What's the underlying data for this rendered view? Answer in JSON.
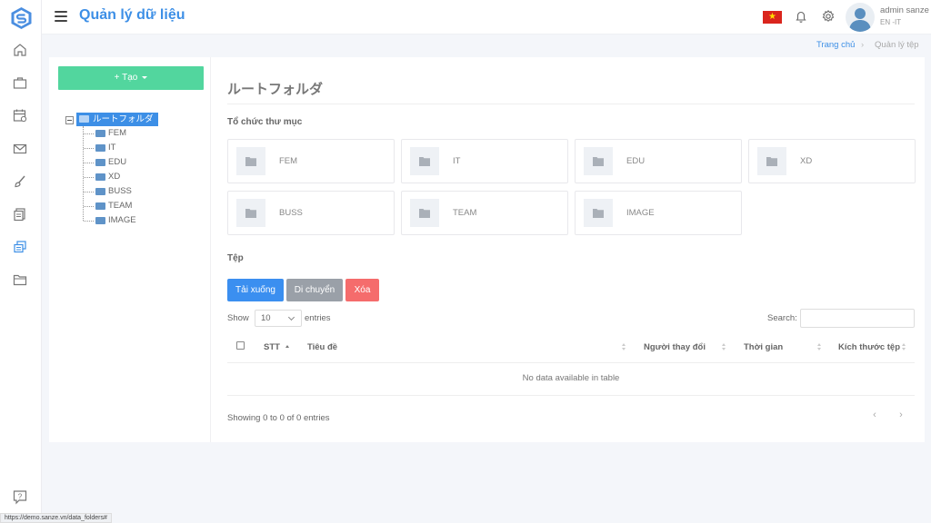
{
  "header": {
    "title": "Quản lý dữ liệu",
    "user_name": "admin sanze",
    "user_sub": "EN -IT",
    "flag_star": "★"
  },
  "sidebar": {
    "items": [
      {
        "name": "home-icon"
      },
      {
        "name": "briefcase-icon"
      },
      {
        "name": "calendar-icon"
      },
      {
        "name": "mail-icon"
      },
      {
        "name": "brush-icon"
      },
      {
        "name": "documents-icon"
      },
      {
        "name": "database-icon",
        "active": true
      },
      {
        "name": "folder-icon"
      }
    ],
    "help_icon": "help-icon"
  },
  "breadcrumb": {
    "home": "Trang chủ",
    "separator": "›",
    "current": "Quản lý tệp"
  },
  "create_button": "+ Tạo",
  "tree": {
    "root": "ルートフォルダ",
    "children": [
      "FEM",
      "IT",
      "EDU",
      "XD",
      "BUSS",
      "TEAM",
      "IMAGE"
    ]
  },
  "content": {
    "title": "ルートフォルダ",
    "folders_label": "Tổ chức thư mục",
    "folders": [
      "FEM",
      "IT",
      "EDU",
      "XD",
      "BUSS",
      "TEAM",
      "IMAGE"
    ],
    "files_label": "Tệp"
  },
  "actions": {
    "download": "Tải xuống",
    "move": "Di chuyển",
    "delete": "Xóa"
  },
  "table": {
    "show_label": "Show",
    "page_size": "10",
    "entries_label": "entries",
    "search_label": "Search:",
    "columns": [
      "STT",
      "Tiêu đề",
      "Người thay đổi",
      "Thời gian",
      "Kích thước tệp"
    ],
    "empty_text": "No data available in table",
    "info_text": "Showing 0 to 0 of 0 entries",
    "prev": "‹",
    "next": "›"
  },
  "status_url": "https://demo.sanze.vn/data_folders#",
  "colors": {
    "accent": "#3d8fe6",
    "create": "#52d69e",
    "download": "#3b8ff0",
    "move": "#9aa0a8",
    "delete": "#f56c6c"
  }
}
